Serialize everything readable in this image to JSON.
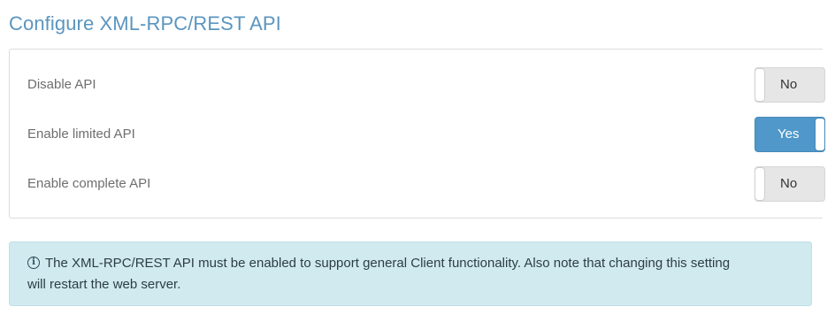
{
  "page": {
    "title": "Configure XML-RPC/REST API"
  },
  "settings": [
    {
      "label": "Disable API",
      "value_text": "No",
      "state": "off"
    },
    {
      "label": "Enable limited API",
      "value_text": "Yes",
      "state": "on"
    },
    {
      "label": "Enable complete API",
      "value_text": "No",
      "state": "off"
    }
  ],
  "alert": {
    "icon": "info-circle-icon",
    "text": "The XML-RPC/REST API must be enabled to support general Client functionality. Also note that changing this setting will restart the web server."
  },
  "colors": {
    "title": "#5b95bf",
    "toggle_on": "#4f98c9",
    "toggle_off": "#e6e6e6",
    "alert_bg": "#d1eaf0"
  }
}
